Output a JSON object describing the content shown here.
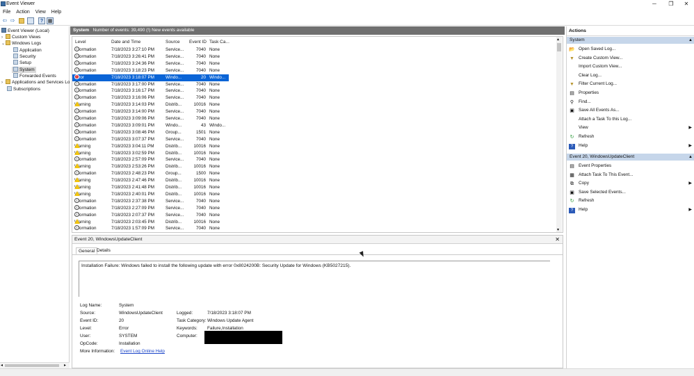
{
  "window": {
    "title": "Event Viewer",
    "minimize": "─",
    "maximize": "❐",
    "close": "✕"
  },
  "menu": [
    "File",
    "Action",
    "View",
    "Help"
  ],
  "toolbar": {
    "back": "⇦",
    "forward": "⇨",
    "up": "▲",
    "help": "?",
    "pane": "▦"
  },
  "tree": {
    "root": "Event Viewer (Local)",
    "custom_views": "Custom Views",
    "windows_logs": "Windows Logs",
    "application": "Application",
    "security": "Security",
    "setup": "Setup",
    "system": "System",
    "forwarded": "Forwarded Events",
    "app_services": "Applications and Services Lo",
    "subscriptions": "Subscriptions"
  },
  "log_header": {
    "name": "System",
    "info": "Number of events: 39,490 (!) New events available"
  },
  "columns": {
    "level": "Level",
    "datetime": "Date and Time",
    "source": "Source",
    "event_id": "Event ID",
    "task": "Task Ca..."
  },
  "events": [
    {
      "level": "Information",
      "icon": "info",
      "datetime": "7/18/2023 3:27:10 PM",
      "source": "Service...",
      "event_id": "7040",
      "task": "None"
    },
    {
      "level": "Information",
      "icon": "info",
      "datetime": "7/18/2023 3:26:41 PM",
      "source": "Service...",
      "event_id": "7040",
      "task": "None"
    },
    {
      "level": "Information",
      "icon": "info",
      "datetime": "7/18/2023 3:24:36 PM",
      "source": "Service...",
      "event_id": "7040",
      "task": "None"
    },
    {
      "level": "Information",
      "icon": "info",
      "datetime": "7/18/2023 3:18:23 PM",
      "source": "Service...",
      "event_id": "7040",
      "task": "None"
    },
    {
      "level": "Error",
      "icon": "error",
      "datetime": "7/18/2023 3:18:07 PM",
      "source": "Windo...",
      "event_id": "20",
      "task": "Windo...",
      "selected": true
    },
    {
      "level": "Information",
      "icon": "info",
      "datetime": "7/18/2023 3:17:00 PM",
      "source": "Service...",
      "event_id": "7040",
      "task": "None"
    },
    {
      "level": "Information",
      "icon": "info",
      "datetime": "7/18/2023 3:16:17 PM",
      "source": "Service...",
      "event_id": "7040",
      "task": "None"
    },
    {
      "level": "Information",
      "icon": "info",
      "datetime": "7/18/2023 3:16:06 PM",
      "source": "Service...",
      "event_id": "7040",
      "task": "None"
    },
    {
      "level": "Warning",
      "icon": "warn",
      "datetime": "7/18/2023 3:14:03 PM",
      "source": "Distrib...",
      "event_id": "10016",
      "task": "None"
    },
    {
      "level": "Information",
      "icon": "info",
      "datetime": "7/18/2023 3:14:00 PM",
      "source": "Service...",
      "event_id": "7040",
      "task": "None"
    },
    {
      "level": "Information",
      "icon": "info",
      "datetime": "7/18/2023 3:09:06 PM",
      "source": "Service...",
      "event_id": "7040",
      "task": "None"
    },
    {
      "level": "Information",
      "icon": "info",
      "datetime": "7/18/2023 3:09:01 PM",
      "source": "Windo...",
      "event_id": "43",
      "task": "Windo..."
    },
    {
      "level": "Information",
      "icon": "info",
      "datetime": "7/18/2023 3:08:46 PM",
      "source": "Group...",
      "event_id": "1501",
      "task": "None"
    },
    {
      "level": "Information",
      "icon": "info",
      "datetime": "7/18/2023 3:07:37 PM",
      "source": "Service...",
      "event_id": "7040",
      "task": "None"
    },
    {
      "level": "Warning",
      "icon": "warn",
      "datetime": "7/18/2023 3:04:11 PM",
      "source": "Distrib...",
      "event_id": "10016",
      "task": "None"
    },
    {
      "level": "Warning",
      "icon": "warn",
      "datetime": "7/18/2023 3:02:59 PM",
      "source": "Distrib...",
      "event_id": "10016",
      "task": "None"
    },
    {
      "level": "Information",
      "icon": "info",
      "datetime": "7/18/2023 2:57:09 PM",
      "source": "Service...",
      "event_id": "7040",
      "task": "None"
    },
    {
      "level": "Warning",
      "icon": "warn",
      "datetime": "7/18/2023 2:53:26 PM",
      "source": "Distrib...",
      "event_id": "10016",
      "task": "None"
    },
    {
      "level": "Information",
      "icon": "info",
      "datetime": "7/18/2023 2:48:23 PM",
      "source": "Group...",
      "event_id": "1500",
      "task": "None"
    },
    {
      "level": "Warning",
      "icon": "warn",
      "datetime": "7/18/2023 2:47:46 PM",
      "source": "Distrib...",
      "event_id": "10016",
      "task": "None"
    },
    {
      "level": "Warning",
      "icon": "warn",
      "datetime": "7/18/2023 2:41:48 PM",
      "source": "Distrib...",
      "event_id": "10016",
      "task": "None"
    },
    {
      "level": "Warning",
      "icon": "warn",
      "datetime": "7/18/2023 2:40:01 PM",
      "source": "Distrib...",
      "event_id": "10016",
      "task": "None"
    },
    {
      "level": "Information",
      "icon": "info",
      "datetime": "7/18/2023 2:37:38 PM",
      "source": "Service...",
      "event_id": "7040",
      "task": "None"
    },
    {
      "level": "Information",
      "icon": "info",
      "datetime": "7/18/2023 2:27:09 PM",
      "source": "Service...",
      "event_id": "7040",
      "task": "None"
    },
    {
      "level": "Information",
      "icon": "info",
      "datetime": "7/18/2023 2:07:37 PM",
      "source": "Service...",
      "event_id": "7040",
      "task": "None"
    },
    {
      "level": "Warning",
      "icon": "warn",
      "datetime": "7/18/2023 2:03:45 PM",
      "source": "Distrib...",
      "event_id": "10016",
      "task": "None"
    },
    {
      "level": "Information",
      "icon": "info",
      "datetime": "7/18/2023 1:57:09 PM",
      "source": "Service...",
      "event_id": "7040",
      "task": "None"
    }
  ],
  "detail": {
    "title": "Event 20, WindowsUpdateClient",
    "close": "✕",
    "tab_general": "General",
    "tab_details": "Details",
    "message": "Installation Failure: Windows failed to install the following update with error 0x8024200B: Security Update for Windows (KB5027215).",
    "log_name_label": "Log Name:",
    "log_name": "System",
    "source_label": "Source:",
    "source": "WindowsUpdateClient",
    "event_id_label": "Event ID:",
    "event_id": "20",
    "level_label": "Level:",
    "level": "Error",
    "user_label": "User:",
    "user": "SYSTEM",
    "opcode_label": "OpCode:",
    "opcode": "Installation",
    "more_info_label": "More Information:",
    "more_info_link": "Event Log Online Help",
    "logged_label": "Logged:",
    "logged": "7/18/2023 3:18:07 PM",
    "task_category_label": "Task Category:",
    "task_category": "Windows Update Agent",
    "keywords_label": "Keywords:",
    "keywords": "Failure,Installation",
    "computer_label": "Computer:"
  },
  "actions": {
    "title": "Actions",
    "section_system": "System",
    "system_items": [
      {
        "label": "Open Saved Log...",
        "icon": "folder-icon",
        "glyph": "📂"
      },
      {
        "label": "Create Custom View...",
        "icon": "filter-icon",
        "glyph": "▼"
      },
      {
        "label": "Import Custom View...",
        "icon": "import-icon",
        "glyph": ""
      },
      {
        "label": "Clear Log...",
        "icon": "clear-icon",
        "glyph": ""
      },
      {
        "label": "Filter Current Log...",
        "icon": "filter-icon",
        "glyph": "▼"
      },
      {
        "label": "Properties",
        "icon": "properties-icon",
        "glyph": "▤"
      },
      {
        "label": "Find...",
        "icon": "find-icon",
        "glyph": "⚲"
      },
      {
        "label": "Save All Events As...",
        "icon": "save-icon",
        "glyph": "▣"
      },
      {
        "label": "Attach a Task To this Log...",
        "icon": "task-icon",
        "glyph": ""
      },
      {
        "label": "View",
        "icon": "view-icon",
        "glyph": "",
        "submenu": true
      },
      {
        "label": "Refresh",
        "icon": "refresh-icon",
        "glyph": "↻"
      },
      {
        "label": "Help",
        "icon": "help-icon",
        "glyph": "?",
        "submenu": true
      }
    ],
    "section_event": "Event 20, WindowsUpdateClient",
    "event_items": [
      {
        "label": "Event Properties",
        "icon": "properties-icon",
        "glyph": "▤"
      },
      {
        "label": "Attach Task To This Event...",
        "icon": "task-icon",
        "glyph": "▦"
      },
      {
        "label": "Copy",
        "icon": "copy-icon",
        "glyph": "⧉",
        "submenu": true
      },
      {
        "label": "Save Selected Events...",
        "icon": "save-icon",
        "glyph": "▣"
      },
      {
        "label": "Refresh",
        "icon": "refresh-icon",
        "glyph": "↻"
      },
      {
        "label": "Help",
        "icon": "help-icon",
        "glyph": "?",
        "submenu": true
      }
    ],
    "collapse_glyph": "▲",
    "submenu_glyph": "▶"
  }
}
